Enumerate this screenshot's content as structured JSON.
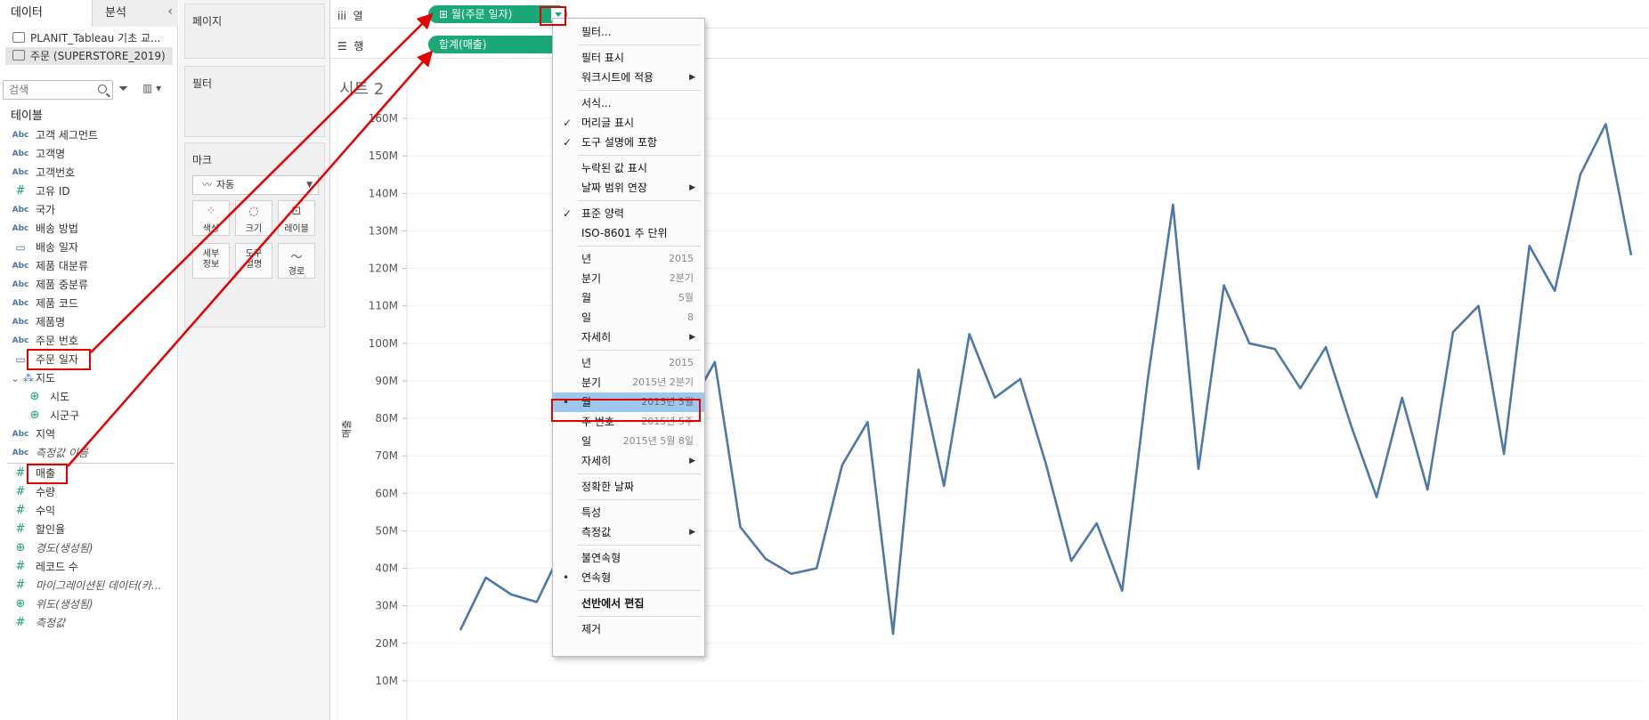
{
  "data_pane": {
    "tabs": [
      "데이터",
      "분석"
    ],
    "collapse_icon": "‹",
    "datasources": [
      "PLANIT_Tableau 기초 교...",
      "주문 (SUPERSTORE_2019)"
    ],
    "search_placeholder": "검색",
    "section_title": "테이블",
    "fields": [
      {
        "type": "Abc",
        "label": "고객 세그먼트"
      },
      {
        "type": "Abc",
        "label": "고객명"
      },
      {
        "type": "Abc",
        "label": "고객번호"
      },
      {
        "type": "#",
        "label": "고유 ID"
      },
      {
        "type": "Abc",
        "label": "국가"
      },
      {
        "type": "Abc",
        "label": "배송 방법"
      },
      {
        "type": "date",
        "label": "배송 일자"
      },
      {
        "type": "Abc",
        "label": "제품 대분류"
      },
      {
        "type": "Abc",
        "label": "제품 중분류"
      },
      {
        "type": "Abc",
        "label": "제품 코드"
      },
      {
        "type": "Abc",
        "label": "제품명"
      },
      {
        "type": "Abc",
        "label": "주문 번호"
      },
      {
        "type": "date",
        "label": "주문 일자"
      },
      {
        "type": "hier",
        "label": "지도"
      },
      {
        "type": "geo",
        "label": "시도"
      },
      {
        "type": "geo",
        "label": "시군구"
      },
      {
        "type": "Abc",
        "label": "지역"
      },
      {
        "type": "Abc",
        "label": "측정값 이름"
      }
    ],
    "measures": [
      {
        "type": "#",
        "label": "매출"
      },
      {
        "type": "#",
        "label": "수량"
      },
      {
        "type": "#",
        "label": "수익"
      },
      {
        "type": "#",
        "label": "할인율"
      },
      {
        "type": "geo",
        "label": "경도(생성됨)"
      },
      {
        "type": "#",
        "label": "레코드 수"
      },
      {
        "type": "#",
        "label": "마이그레이션된 데이터(카..."
      },
      {
        "type": "geo",
        "label": "위도(생성됨)"
      },
      {
        "type": "#",
        "label": "측정값"
      }
    ]
  },
  "shelves": {
    "pages": "페이지",
    "filters": "필터",
    "marks": "마크",
    "mark_type": "자동",
    "mark_buttons": [
      "색상",
      "크기",
      "레이블",
      "세부\n정보",
      "도구\n설명",
      "경로"
    ]
  },
  "columns_shelf": {
    "label": "열",
    "icon": "iii",
    "pill": "월(주문 일자)"
  },
  "rows_shelf": {
    "label": "행",
    "icon": "☰",
    "pill": "합계(매출)"
  },
  "sheet": {
    "title": "시트 2",
    "y_axis_label": "매출",
    "y_ticks": [
      "160M",
      "150M",
      "140M",
      "130M",
      "120M",
      "110M",
      "100M",
      "90M",
      "80M",
      "70M",
      "60M",
      "50M",
      "40M",
      "30M",
      "20M",
      "10M"
    ]
  },
  "context_menu": [
    {
      "label": "필터...",
      "sep_after": true
    },
    {
      "label": "필터 표시"
    },
    {
      "label": "워크시트에 적용",
      "submenu": true,
      "sep_after": true
    },
    {
      "label": "서식..."
    },
    {
      "label": "머리글 표시",
      "check": "✓"
    },
    {
      "label": "도구 설명에 포함",
      "check": "✓",
      "sep_after": true
    },
    {
      "label": "누락된 값 표시"
    },
    {
      "label": "날짜 범위 연장",
      "submenu": true,
      "sep_after": true
    },
    {
      "label": "표준 양력",
      "check": "✓"
    },
    {
      "label": "ISO-8601 주 단위",
      "sep_after": true
    },
    {
      "label": "년",
      "right": "2015"
    },
    {
      "label": "분기",
      "right": "2분기"
    },
    {
      "label": "월",
      "right": "5월"
    },
    {
      "label": "일",
      "right": "8"
    },
    {
      "label": "자세히",
      "submenu": true,
      "sep_after": true
    },
    {
      "label": "년",
      "right": "2015"
    },
    {
      "label": "분기",
      "right": "2015년 2분기"
    },
    {
      "label": "월",
      "right": "2015년 5월",
      "check": "•",
      "highlight": true
    },
    {
      "label": "주 번호",
      "right": "2015년 5주"
    },
    {
      "label": "일",
      "right": "2015년 5월 8일"
    },
    {
      "label": "자세히",
      "submenu": true,
      "sep_after": true
    },
    {
      "label": "정확한 날짜",
      "sep_after": true
    },
    {
      "label": "특성"
    },
    {
      "label": "측정값",
      "submenu": true,
      "sep_after": true
    },
    {
      "label": "불연속형"
    },
    {
      "label": "연속형",
      "check": "•",
      "sep_after": true
    },
    {
      "label": "선반에서 편집",
      "bold": true,
      "sep_after": true
    },
    {
      "label": "제거"
    }
  ],
  "chart_data": {
    "type": "line",
    "title": "시트 2",
    "xlabel": "",
    "ylabel": "매출",
    "ylim": [
      0,
      165
    ],
    "y_unit": "M",
    "series": [
      {
        "values": [
          23.5,
          37.5,
          33,
          31,
          45,
          52,
          60,
          68,
          75,
          83,
          95,
          51,
          42.5,
          38.5,
          40,
          67.5,
          79,
          22.5,
          93,
          62,
          102.5,
          85.5,
          90.5,
          68,
          42,
          52,
          34,
          90,
          137,
          66.5,
          115.5,
          100,
          98.5,
          88,
          99,
          78,
          59,
          85.5,
          61,
          103,
          110,
          70.5,
          126,
          114,
          145,
          158.5,
          123.5
        ]
      }
    ],
    "line_color": "#4e79a7",
    "grid": true
  }
}
